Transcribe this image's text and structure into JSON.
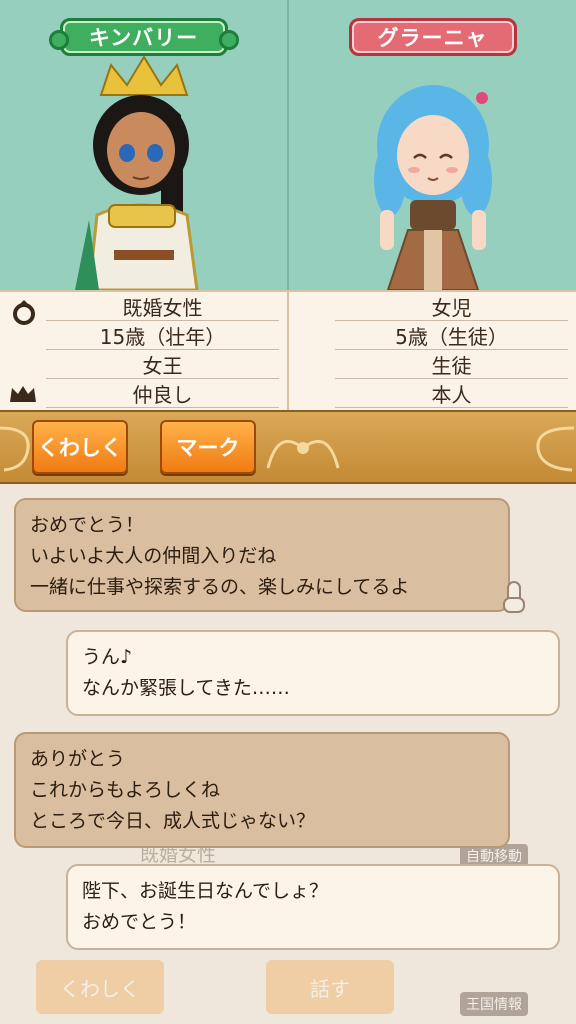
{
  "left_character": {
    "name": "キンバリー",
    "info": [
      "既婚女性",
      "15歳（壮年）",
      "女王",
      "仲良し"
    ]
  },
  "right_character": {
    "name": "グラーニャ",
    "info": [
      "女児",
      "5歳（生徒）",
      "生徒",
      "本人"
    ]
  },
  "buttons": {
    "details": "くわしく",
    "mark": "マーク"
  },
  "dialogue": [
    {
      "side": "left",
      "text": "おめでとう！\nいよいよ大人の仲間入りだね\n一緒に仕事や探索するの、楽しみにしてるよ"
    },
    {
      "side": "right",
      "text": "うん♪\nなんか緊張してきた……"
    },
    {
      "side": "left",
      "text": "ありがとう\nこれからもよろしくね\nところで今日、成人式じゃない？"
    },
    {
      "side": "right",
      "text": "陛下、お誕生日なんでしょ？\nおめでとう！"
    }
  ],
  "background_faded": {
    "info_text": "既婚女性",
    "details_button": "くわしく",
    "talk_button": "話す",
    "auto_move": "自動移動",
    "kingdom_info": "王国情報"
  },
  "colors": {
    "portrait_bg": "#96cfbe",
    "name_green": "#3fae5e",
    "name_red": "#e46a73",
    "button_orange": "#f07b12",
    "bar_gold": "#d9a958"
  }
}
